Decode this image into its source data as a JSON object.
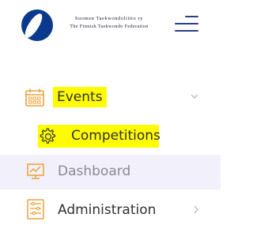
{
  "header": {
    "org_line1": "Suomen Taekwondoliitto ry",
    "org_line2": "The Finnish Taekwondo Federation",
    "logo_icon": "federation-logo",
    "menu_icon": "hamburger-menu-icon"
  },
  "nav": {
    "events": {
      "label": "Events",
      "icon": "calendar-icon",
      "expanded": true,
      "highlighted": true
    },
    "competitions": {
      "label": "Competitions",
      "icon": "gear-icon",
      "highlighted": true
    },
    "dashboard": {
      "label": "Dashboard",
      "icon": "chart-icon",
      "active": true
    },
    "administration": {
      "label": "Administration",
      "icon": "admin-panel-icon"
    }
  },
  "colors": {
    "brand_blue": "#0b3a8d",
    "menu_icon_blue": "#2a3e86",
    "highlight": "#fffb00",
    "active_bg": "#f2f0fa",
    "accent_orange": "#e9a33b",
    "label_dark": "#2f3133",
    "label_muted": "#8a8a93"
  }
}
